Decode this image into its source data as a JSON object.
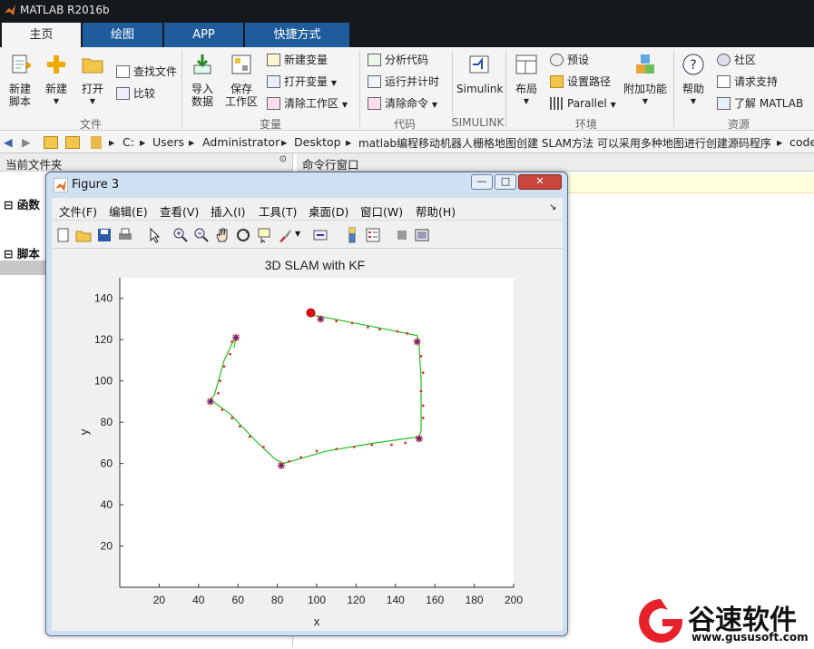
{
  "app": {
    "title": "MATLAB R2016b"
  },
  "tabs": [
    "主页",
    "绘图",
    "APP",
    "快捷方式"
  ],
  "ribbon": {
    "new_script": [
      "新建",
      "脚本"
    ],
    "new": "新建",
    "open": "打开",
    "find_files": "查找文件",
    "compare": "比较",
    "import": [
      "导入",
      "数据"
    ],
    "save_ws": [
      "保存",
      "工作区"
    ],
    "new_var": "新建变量",
    "open_var": "打开变量",
    "clear_ws": "清除工作区",
    "analyze": "分析代码",
    "run_time": "运行并计时",
    "clear_cmd": "清除命令",
    "simulink": "Simulink",
    "layout": "布局",
    "prefs": "预设",
    "set_path": "设置路径",
    "parallel": "Parallel",
    "addons": "附加功能",
    "help": "帮助",
    "community": "社区",
    "support": "请求支持",
    "learn": "了解 MATLAB",
    "groups": [
      "文件",
      "变量",
      "代码",
      "SIMULINK",
      "环境",
      "资源"
    ]
  },
  "address": {
    "path": [
      "C:",
      "Users",
      "Administrator",
      "Desktop",
      "matlab编程移动机器人栅格地图创建 SLAM方法 可以采用多种地图进行创建源码程序",
      "code"
    ]
  },
  "left_panel": {
    "title": "当前文件夹",
    "section_functions": "函数",
    "section_scripts": "脚本"
  },
  "cmd_window": {
    "title": "命令行窗口"
  },
  "figure": {
    "title": "Figure 3",
    "menus": [
      "文件(F)",
      "编辑(E)",
      "查看(V)",
      "插入(I)",
      "工具(T)",
      "桌面(D)",
      "窗口(W)",
      "帮助(H)"
    ]
  },
  "chart_data": {
    "type": "line",
    "title": "3D SLAM with KF",
    "xlabel": "x",
    "ylabel": "y",
    "xlim": [
      0,
      200
    ],
    "ylim": [
      0,
      150
    ],
    "xticks": [
      20,
      40,
      60,
      80,
      100,
      120,
      140,
      160,
      180,
      200
    ],
    "yticks": [
      20,
      40,
      60,
      80,
      100,
      120,
      140
    ],
    "grid": false,
    "series": [
      {
        "role": "estimated-path",
        "color": "#22c022",
        "points": [
          [
            97,
            132
          ],
          [
            103,
            131
          ],
          [
            125,
            127
          ],
          [
            151,
            122
          ],
          [
            152,
            118
          ],
          [
            153,
            100
          ],
          [
            153,
            76
          ],
          [
            152,
            73
          ],
          [
            130,
            70
          ],
          [
            105,
            66
          ],
          [
            83,
            60
          ],
          [
            79,
            62
          ],
          [
            70,
            70
          ],
          [
            56,
            84
          ],
          [
            46,
            91
          ],
          [
            48,
            93
          ],
          [
            53,
            110
          ],
          [
            59,
            122
          ],
          [
            58,
            116
          ]
        ]
      },
      {
        "role": "landmarks",
        "marker": "*",
        "color": "#cc2222",
        "points": [
          [
            102,
            130
          ],
          [
            151,
            119
          ],
          [
            152,
            72
          ],
          [
            82,
            59
          ],
          [
            46,
            90
          ],
          [
            59,
            121
          ]
        ]
      },
      {
        "role": "true-landmarks",
        "marker": "+",
        "color": "#2233cc",
        "points": [
          [
            102,
            130
          ],
          [
            151,
            119
          ],
          [
            152,
            72
          ],
          [
            82,
            59
          ],
          [
            46,
            90
          ],
          [
            59,
            121
          ]
        ]
      },
      {
        "role": "start",
        "marker": "o",
        "color": "#dd1111",
        "points": [
          [
            97,
            133
          ]
        ]
      },
      {
        "role": "observations",
        "marker": ".",
        "color": "#dd3333",
        "points": [
          [
            110,
            129
          ],
          [
            118,
            128
          ],
          [
            126,
            126
          ],
          [
            132,
            125
          ],
          [
            141,
            124
          ],
          [
            146,
            123
          ],
          [
            153,
            112
          ],
          [
            154,
            104
          ],
          [
            153,
            95
          ],
          [
            154,
            88
          ],
          [
            154,
            82
          ],
          [
            145,
            70
          ],
          [
            138,
            69
          ],
          [
            128,
            69
          ],
          [
            119,
            68
          ],
          [
            110,
            67
          ],
          [
            100,
            66
          ],
          [
            92,
            63
          ],
          [
            86,
            61
          ],
          [
            73,
            68
          ],
          [
            66,
            73
          ],
          [
            61,
            78
          ],
          [
            57,
            82
          ],
          [
            52,
            86
          ],
          [
            50,
            94
          ],
          [
            51,
            100
          ],
          [
            53,
            107
          ],
          [
            56,
            113
          ],
          [
            57,
            119
          ]
        ]
      }
    ]
  },
  "watermark": {
    "brand": "谷速软件",
    "url": "www.gususoft.com",
    "color": "#e8202a"
  }
}
